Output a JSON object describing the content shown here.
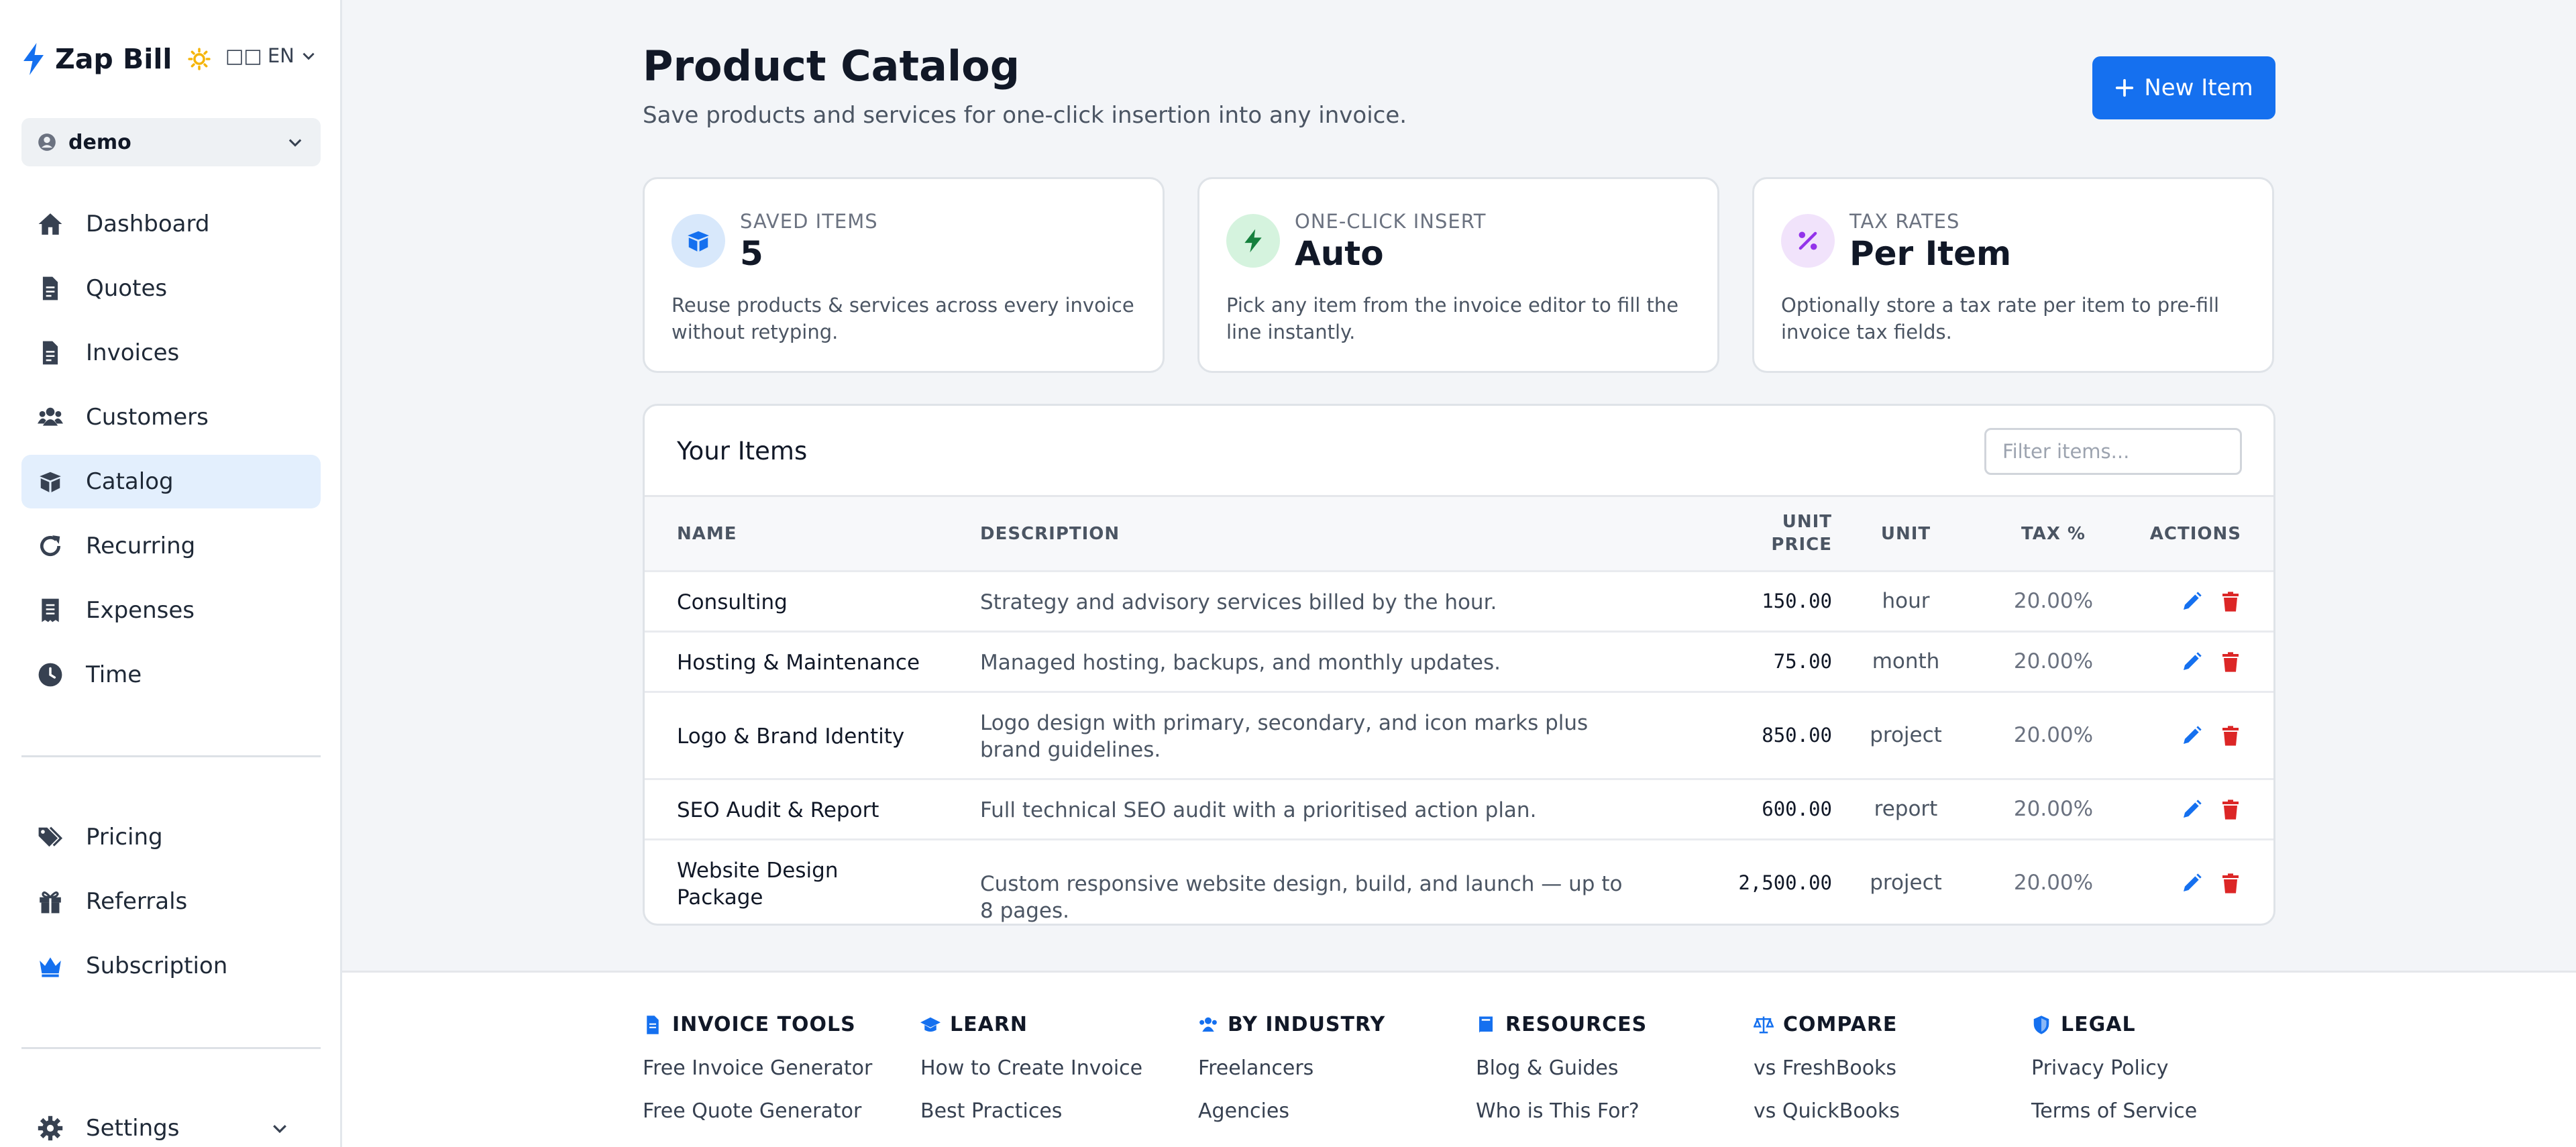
{
  "app": {
    "name": "Zap Bill",
    "language": "EN"
  },
  "account": {
    "name": "demo"
  },
  "nav": {
    "items": [
      {
        "label": "Dashboard"
      },
      {
        "label": "Quotes"
      },
      {
        "label": "Invoices"
      },
      {
        "label": "Customers"
      },
      {
        "label": "Catalog",
        "active": true
      },
      {
        "label": "Recurring"
      },
      {
        "label": "Expenses"
      },
      {
        "label": "Time"
      }
    ],
    "secondary": [
      {
        "label": "Pricing"
      },
      {
        "label": "Referrals"
      },
      {
        "label": "Subscription"
      }
    ],
    "settings": {
      "label": "Settings"
    }
  },
  "page": {
    "title": "Product Catalog",
    "subtitle": "Save products and services for one-click insertion into any invoice.",
    "new_item_label": "New Item"
  },
  "stats": [
    {
      "kicker": "SAVED ITEMS",
      "value": "5",
      "desc": "Reuse products & services across every invoice without retyping."
    },
    {
      "kicker": "ONE-CLICK INSERT",
      "value": "Auto",
      "desc": "Pick any item from the invoice editor to fill the line instantly."
    },
    {
      "kicker": "TAX RATES",
      "value": "Per Item",
      "desc": "Optionally store a tax rate per item to pre-fill invoice tax fields."
    }
  ],
  "items_table": {
    "title": "Your Items",
    "filter_placeholder": "Filter items...",
    "columns": {
      "name": "NAME",
      "description": "DESCRIPTION",
      "unit_price_1": "UNIT",
      "unit_price_2": "PRICE",
      "unit": "UNIT",
      "tax": "TAX %",
      "actions": "ACTIONS"
    },
    "rows": [
      {
        "name": "Consulting",
        "description": "Strategy and advisory services billed by the hour.",
        "price": "150.00",
        "unit": "hour",
        "tax": "20.00%"
      },
      {
        "name": "Hosting & Maintenance",
        "description": "Managed hosting, backups, and monthly updates.",
        "price": "75.00",
        "unit": "month",
        "tax": "20.00%"
      },
      {
        "name": "Logo & Brand Identity",
        "description": "Logo design with primary, secondary, and icon marks plus brand guidelines.",
        "price": "850.00",
        "unit": "project",
        "tax": "20.00%"
      },
      {
        "name": "SEO Audit & Report",
        "description": "Full technical SEO audit with a prioritised action plan.",
        "price": "600.00",
        "unit": "report",
        "tax": "20.00%"
      },
      {
        "name": "Website Design Package",
        "description": "Custom responsive website design, build, and launch — up to 8 pages.",
        "price": "2,500.00",
        "unit": "project",
        "tax": "20.00%"
      }
    ]
  },
  "footer": {
    "columns": [
      {
        "heading": "INVOICE TOOLS",
        "icon": "file-icon",
        "links": [
          "Free Invoice Generator",
          "Free Quote Generator"
        ]
      },
      {
        "heading": "LEARN",
        "icon": "graduation-cap-icon",
        "links": [
          "How to Create Invoice",
          "Best Practices"
        ]
      },
      {
        "heading": "BY INDUSTRY",
        "icon": "users-icon",
        "links": [
          "Freelancers",
          "Agencies"
        ]
      },
      {
        "heading": "RESOURCES",
        "icon": "book-icon",
        "links": [
          "Blog & Guides",
          "Who is This For?"
        ]
      },
      {
        "heading": "COMPARE",
        "icon": "scale-icon",
        "links": [
          "vs FreshBooks",
          "vs QuickBooks"
        ]
      },
      {
        "heading": "LEGAL",
        "icon": "shield-icon",
        "links": [
          "Privacy Policy",
          "Terms of Service"
        ]
      }
    ]
  },
  "colors": {
    "accent": "#1570ef",
    "danger": "#dc2626",
    "active_nav_bg": "#e3effd",
    "sun": "#f5b50a"
  }
}
